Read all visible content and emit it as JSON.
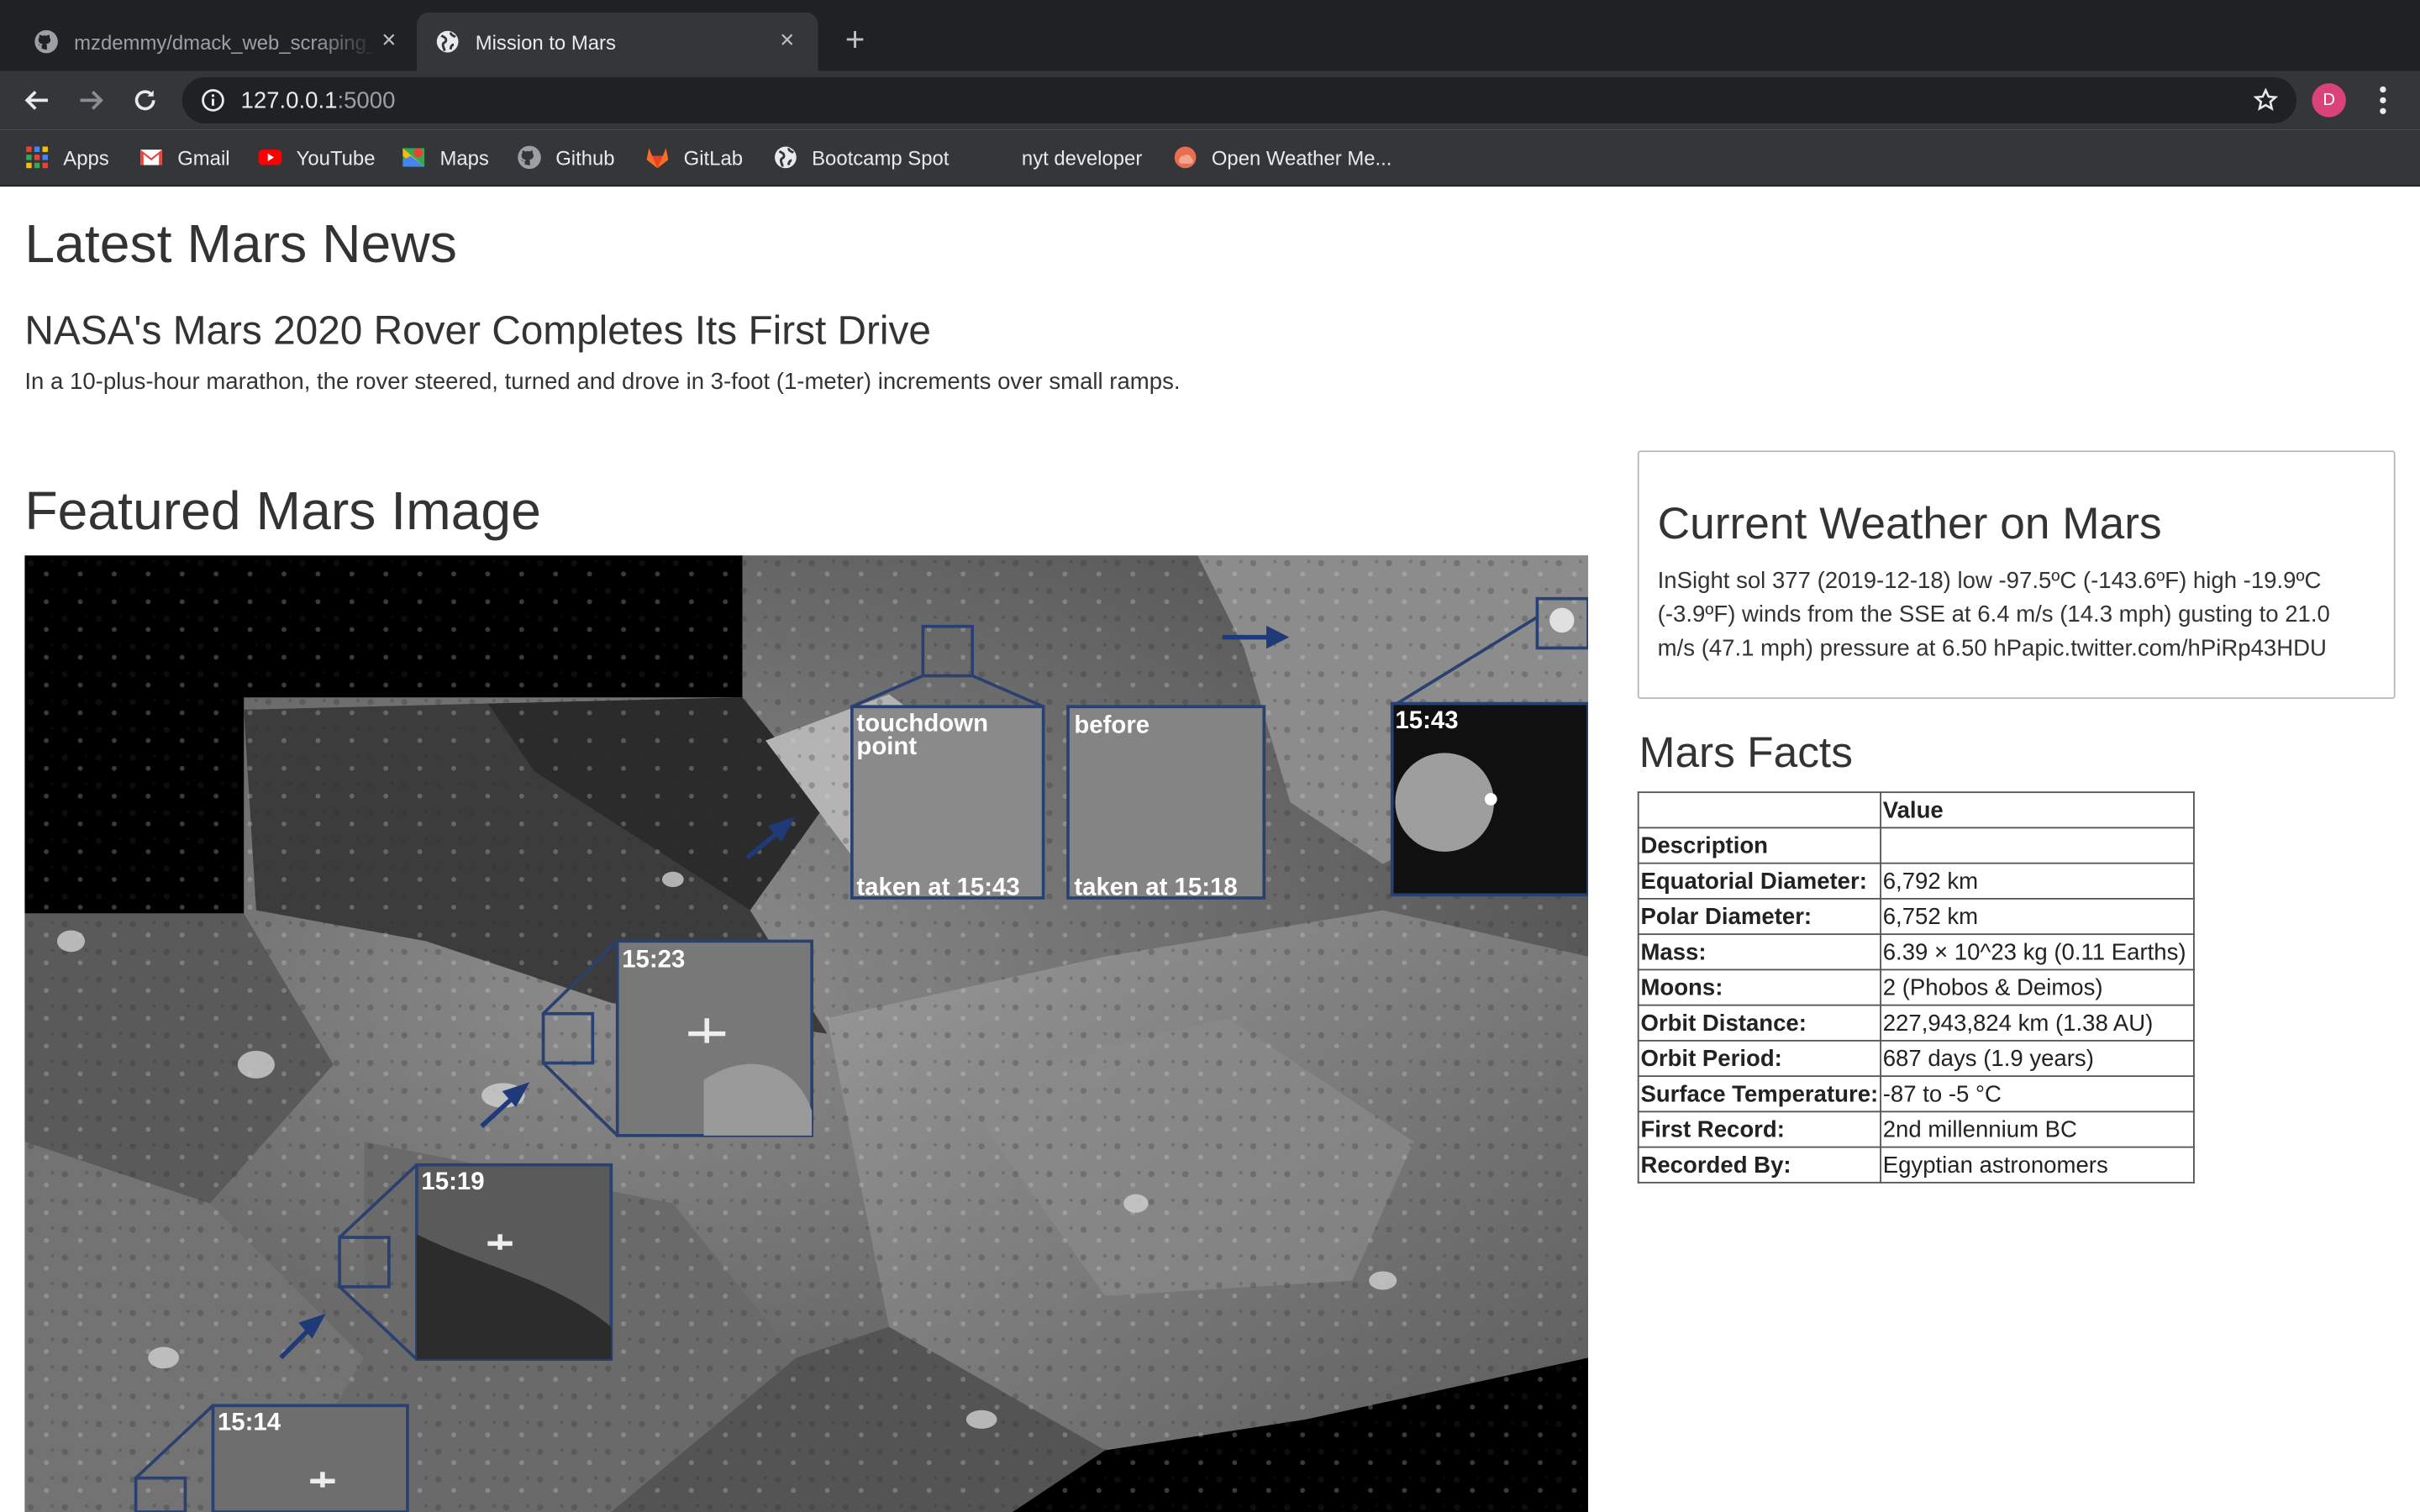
{
  "browser": {
    "tabs": [
      {
        "title": "mzdemmy/dmack_web_scraping_challenge",
        "active": false,
        "favicon": "github-icon"
      },
      {
        "title": "Mission to Mars",
        "active": true,
        "favicon": "globe-icon"
      }
    ],
    "url_host": "127.0.0.1",
    "url_port": ":5000",
    "profile_initial": "D",
    "bookmarks": [
      {
        "label": "Apps",
        "icon": "apps-grid-icon"
      },
      {
        "label": "Gmail",
        "icon": "gmail-icon"
      },
      {
        "label": "YouTube",
        "icon": "youtube-icon"
      },
      {
        "label": "Maps",
        "icon": "maps-icon"
      },
      {
        "label": "Github",
        "icon": "github-icon"
      },
      {
        "label": "GitLab",
        "icon": "gitlab-icon"
      },
      {
        "label": "Bootcamp Spot",
        "icon": "globe-icon"
      },
      {
        "label": "nyt developer",
        "icon": "blank"
      },
      {
        "label": "Open Weather Me...",
        "icon": "openweather-icon"
      }
    ]
  },
  "news": {
    "heading": "Latest Mars News",
    "title": "NASA's Mars 2020 Rover Completes Its First Drive",
    "teaser": "In a 10-plus-hour marathon, the rover steered, turned and drove in 3-foot (1-meter) increments over small ramps."
  },
  "featured": {
    "heading": "Featured Mars Image",
    "labels": {
      "touchdown": "touchdown",
      "point": "point",
      "before": "before",
      "taken_1543": "taken at 15:43",
      "taken_1518": "taken at 15:18",
      "t1543": "15:43",
      "t1523": "15:23",
      "t1519": "15:19",
      "t1514": "15:14"
    }
  },
  "weather": {
    "heading": "Current Weather on Mars",
    "text": "InSight sol 377 (2019-12-18) low -97.5ºC (-143.6ºF) high -19.9ºC (-3.9ºF) winds from the SSE at 6.4 m/s (14.3 mph) gusting to 21.0 m/s (47.1 mph) pressure at 6.50 hPapic.twitter.com/hPiRp43HDU"
  },
  "facts": {
    "heading": "Mars Facts",
    "value_header": "Value",
    "rows": [
      {
        "label": "Description",
        "value": ""
      },
      {
        "label": "Equatorial Diameter:",
        "value": "6,792 km"
      },
      {
        "label": "Polar Diameter:",
        "value": "6,752 km"
      },
      {
        "label": "Mass:",
        "value": "6.39 × 10^23 kg (0.11 Earths)"
      },
      {
        "label": "Moons:",
        "value": "2 (Phobos & Deimos)"
      },
      {
        "label": "Orbit Distance:",
        "value": "227,943,824 km (1.38 AU)"
      },
      {
        "label": "Orbit Period:",
        "value": "687 days (1.9 years)"
      },
      {
        "label": "Surface Temperature:",
        "value": "-87 to -5 °C"
      },
      {
        "label": "First Record:",
        "value": "2nd millennium BC"
      },
      {
        "label": "Recorded By:",
        "value": "Egyptian astronomers"
      }
    ]
  },
  "colors": {
    "chrome_dark": "#202124",
    "chrome_toolbar": "#35363a",
    "avatar": "#d9437a",
    "inset_frame": "#2a4070"
  }
}
